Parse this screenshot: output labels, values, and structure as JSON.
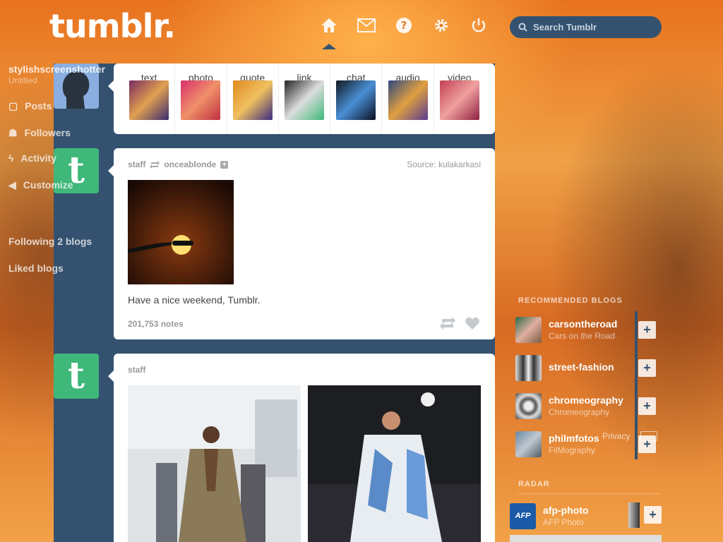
{
  "header": {
    "logo": "tumblr.",
    "search_placeholder": "Search Tumblr",
    "nav_icons": [
      "home-icon",
      "mail-icon",
      "help-icon",
      "gear-icon",
      "power-icon"
    ]
  },
  "post_types": [
    {
      "label": "text",
      "icon": "text-icon",
      "color": "#c63a48"
    },
    {
      "label": "photo",
      "icon": "camera-icon",
      "color": "#e25468"
    },
    {
      "label": "quote",
      "icon": "quote-icon",
      "color": "#f0a02a"
    },
    {
      "label": "link",
      "icon": "link-icon",
      "color": "#3fb87a"
    },
    {
      "label": "chat",
      "icon": "chat-icon",
      "color": "#4a8fd6"
    },
    {
      "label": "audio",
      "icon": "headphones-icon",
      "color": "#7c5cc4"
    },
    {
      "label": "video",
      "icon": "video-icon",
      "color": "#d8485e"
    }
  ],
  "posts": [
    {
      "author": "staff",
      "reblogged_from": "onceablonde",
      "source_label": "Source:",
      "source_name": "kulakarkasi",
      "caption": "Have a nice weekend, Tumblr.",
      "notes": "201,753 notes"
    },
    {
      "author": "staff"
    }
  ],
  "sidebar": {
    "blog_name": "stylishscreenshotter",
    "blog_sub": "Untitled",
    "items": [
      "Posts",
      "Followers",
      "Activity",
      "Customize"
    ],
    "following": "Following 2 blogs",
    "liked": "Liked blogs",
    "recommended_heading": "RECOMMENDED BLOGS",
    "recommended": [
      {
        "name": "carsontheroad",
        "sub": "Cars on the Road"
      },
      {
        "name": "street-fashion",
        "sub": ""
      },
      {
        "name": "chromeography",
        "sub": "Chromeography"
      },
      {
        "name": "philmfotos",
        "sub": "FilMography"
      }
    ],
    "privacy": "Privacy",
    "radar_heading": "RADAR",
    "radar": {
      "name": "afp-photo",
      "sub": "AFP Photo",
      "badge": "AFP"
    }
  },
  "colors": {
    "dashboard": "#34526f",
    "tumblr_green": "#3fb87a"
  }
}
